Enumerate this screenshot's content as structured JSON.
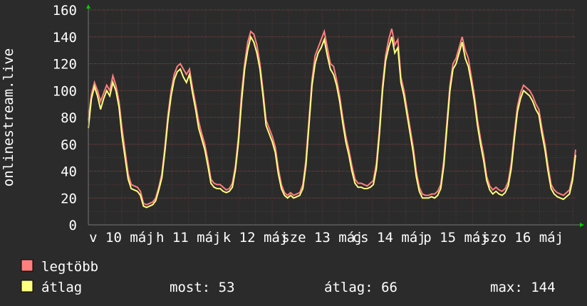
{
  "chart_data": {
    "type": "line",
    "ylabel": "onlinestream.live",
    "ylim": [
      0,
      160
    ],
    "yticks": [
      "0",
      "20",
      "40",
      "60",
      "80",
      "100",
      "120",
      "140",
      "160"
    ],
    "xlim": [
      0,
      7.29
    ],
    "xticks": [
      {
        "label": "v 10 máj",
        "x": 0.5
      },
      {
        "label": "h 11 máj",
        "x": 1.5
      },
      {
        "label": "k 12 máj",
        "x": 2.5
      },
      {
        "label": "sze 13 máj",
        "x": 3.5
      },
      {
        "label": "cs 14 máj",
        "x": 4.5
      },
      {
        "label": "p 15 máj",
        "x": 5.5
      },
      {
        "label": "szo 16 máj",
        "x": 6.5
      }
    ],
    "grid": true,
    "legend_position": "bottom-left",
    "series": [
      {
        "name": "legtöbb",
        "color": "#ff7f7f",
        "values": [
          78,
          97,
          106,
          100,
          92,
          98,
          104,
          100,
          111,
          104,
          92,
          72,
          55,
          38,
          30,
          29,
          28,
          25,
          16,
          15,
          16,
          17,
          20,
          28,
          38,
          58,
          82,
          100,
          112,
          118,
          120,
          116,
          112,
          116,
          102,
          90,
          77,
          68,
          60,
          48,
          34,
          31,
          30,
          30,
          28,
          26,
          27,
          31,
          44,
          66,
          98,
          120,
          136,
          144,
          142,
          134,
          120,
          100,
          78,
          72,
          66,
          58,
          42,
          30,
          24,
          22,
          24,
          22,
          23,
          24,
          30,
          48,
          78,
          108,
          126,
          132,
          138,
          144,
          132,
          120,
          118,
          108,
          96,
          80,
          66,
          56,
          44,
          34,
          31,
          31,
          30,
          29,
          31,
          33,
          46,
          72,
          104,
          126,
          138,
          146,
          134,
          138,
          110,
          100,
          86,
          72,
          58,
          40,
          28,
          23,
          22,
          22,
          23,
          23,
          25,
          30,
          48,
          76,
          104,
          120,
          124,
          132,
          140,
          130,
          124,
          110,
          96,
          78,
          64,
          52,
          36,
          29,
          26,
          28,
          26,
          25,
          27,
          32,
          46,
          68,
          88,
          98,
          104,
          102,
          100,
          96,
          90,
          86,
          72,
          60,
          44,
          30,
          26,
          24,
          23,
          22,
          24,
          26,
          36,
          56
        ]
      },
      {
        "name": "átlag",
        "color": "#ffff7f",
        "values": [
          72,
          94,
          103,
          96,
          86,
          94,
          100,
          96,
          106,
          100,
          88,
          66,
          50,
          34,
          27,
          26,
          25,
          22,
          14,
          13,
          14,
          15,
          18,
          26,
          35,
          55,
          78,
          96,
          108,
          114,
          116,
          110,
          106,
          112,
          98,
          86,
          72,
          64,
          56,
          44,
          31,
          28,
          27,
          27,
          25,
          24,
          25,
          28,
          41,
          62,
          92,
          116,
          130,
          140,
          136,
          128,
          116,
          96,
          74,
          68,
          62,
          54,
          38,
          27,
          22,
          20,
          22,
          20,
          21,
          22,
          27,
          44,
          74,
          104,
          120,
          128,
          132,
          138,
          126,
          116,
          112,
          104,
          92,
          76,
          62,
          52,
          40,
          31,
          28,
          28,
          27,
          27,
          28,
          30,
          42,
          68,
          100,
          122,
          132,
          140,
          128,
          132,
          106,
          96,
          82,
          68,
          54,
          36,
          25,
          20,
          20,
          20,
          21,
          20,
          22,
          27,
          44,
          72,
          100,
          116,
          120,
          128,
          136,
          124,
          118,
          106,
          92,
          74,
          60,
          48,
          33,
          26,
          23,
          25,
          23,
          22,
          24,
          29,
          42,
          64,
          84,
          94,
          100,
          98,
          96,
          92,
          86,
          82,
          68,
          56,
          40,
          27,
          23,
          21,
          20,
          19,
          21,
          23,
          33,
          52
        ]
      }
    ]
  },
  "legend": {
    "items": [
      {
        "label": "legtöbb",
        "color": "#ff7f7f"
      },
      {
        "label": "átlag",
        "color": "#ffff7f"
      }
    ]
  },
  "stats": {
    "now": "most: 53",
    "avg": "átlag: 66",
    "max": "max: 144"
  },
  "colors": {
    "background": "#2b2b2b",
    "plot_background": "#2b2b2b",
    "grid": "#5a3a3a",
    "axis_arrow": "#00cc00",
    "text": "#ffffff"
  }
}
